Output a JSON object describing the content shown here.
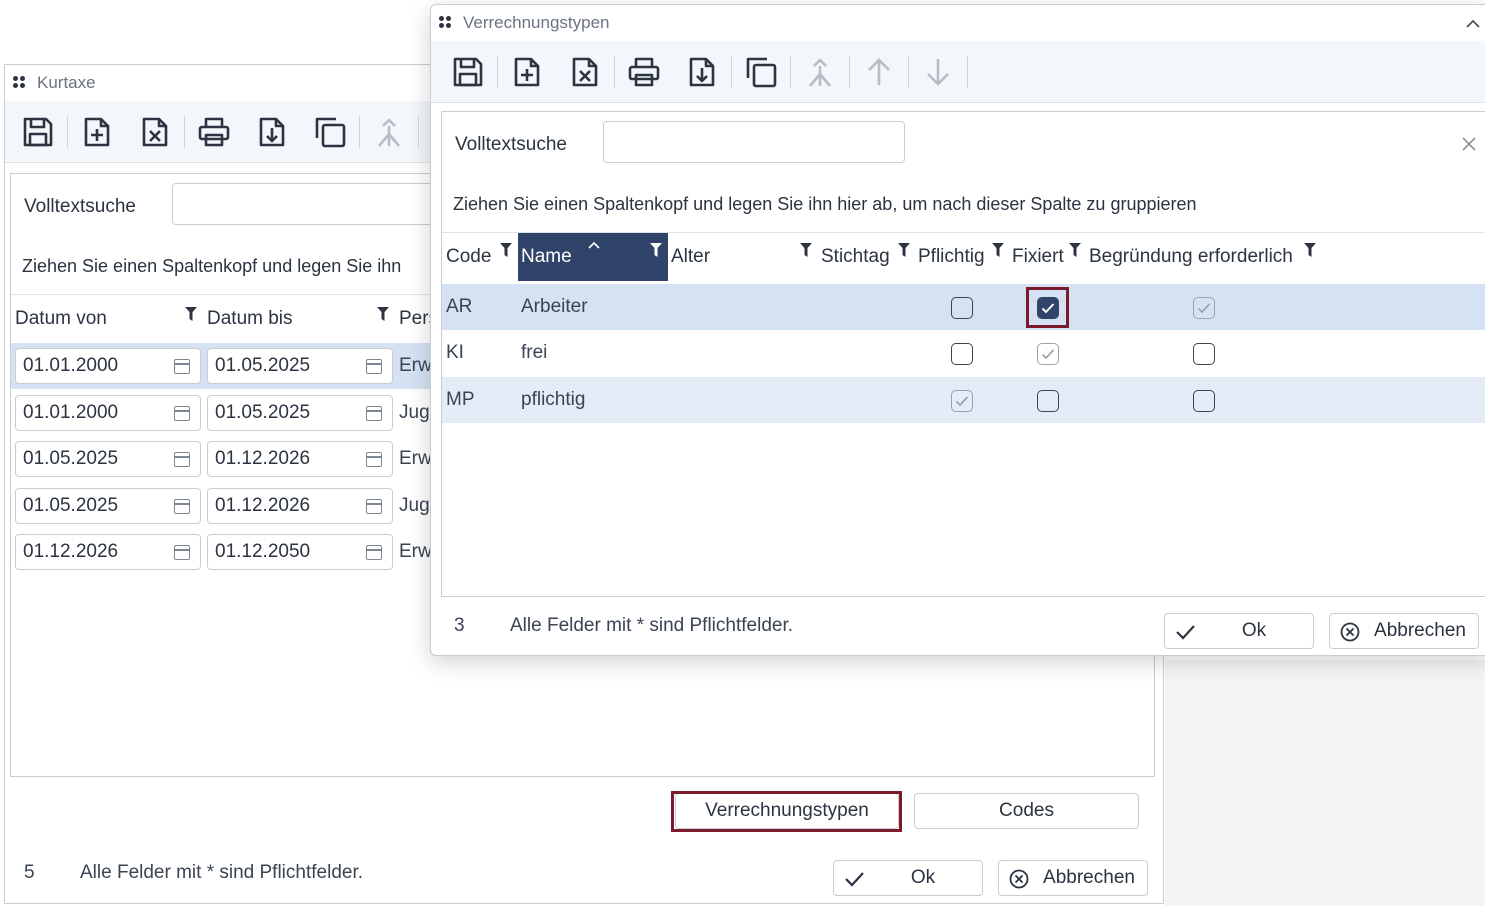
{
  "kurtaxe": {
    "title": "Kurtaxe",
    "search_label": "Volltextsuche",
    "search_value": "",
    "group_hint": "Ziehen Sie einen Spaltenkopf und legen Sie ihn",
    "columns": [
      "Datum von",
      "Datum bis",
      "Pers"
    ],
    "rows": [
      {
        "von": "01.01.2000",
        "bis": "01.05.2025",
        "pers": "Erw"
      },
      {
        "von": "01.01.2000",
        "bis": "01.05.2025",
        "pers": "Juge"
      },
      {
        "von": "01.05.2025",
        "bis": "01.12.2026",
        "pers": "Erw"
      },
      {
        "von": "01.05.2025",
        "bis": "01.12.2026",
        "pers": "Juge"
      },
      {
        "von": "01.12.2026",
        "bis": "01.12.2050",
        "pers": "Erw"
      }
    ],
    "buttons": {
      "verrechnungstypen": "Verrechnungstypen",
      "codes": "Codes",
      "ok": "Ok",
      "abbrechen": "Abbrechen"
    },
    "footer": {
      "count": "5",
      "note": "Alle Felder mit * sind Pflichtfelder."
    }
  },
  "verrechnungstypen": {
    "title": "Verrechnungstypen",
    "search_label": "Volltextsuche",
    "search_value": "",
    "group_hint": "Ziehen Sie einen Spaltenkopf und legen Sie ihn hier ab, um nach dieser Spalte zu gruppieren",
    "columns": [
      "Code",
      "Name",
      "Alter",
      "Stichtag",
      "Pflichtig",
      "Fixiert",
      "Begründung erforderlich"
    ],
    "rows": [
      {
        "code": "AR",
        "name": "Arbeiter",
        "pflichtig": false,
        "fixiert": true,
        "begruendung": true
      },
      {
        "code": "KI",
        "name": "frei",
        "pflichtig": false,
        "fixiert": true,
        "begruendung": false
      },
      {
        "code": "MP",
        "name": "pflichtig",
        "pflichtig": true,
        "fixiert": false,
        "begruendung": false
      }
    ],
    "buttons": {
      "ok": "Ok",
      "abbrechen": "Abbrechen"
    },
    "footer": {
      "count": "3",
      "note": "Alle Felder mit * sind Pflichtfelder."
    }
  },
  "colors": {
    "accent": "#2f4468",
    "selection": "#d4e2f4",
    "highlight": "#7a1a2a"
  },
  "icons": [
    "save-icon",
    "new-document-icon",
    "delete-document-icon",
    "print-icon",
    "export-icon",
    "copy-icon",
    "merge-icon",
    "arrow-up-icon",
    "arrow-down-icon",
    "filter-icon",
    "calendar-icon",
    "check-icon",
    "cancel-circle-icon",
    "close-icon",
    "chevron-up-icon"
  ]
}
